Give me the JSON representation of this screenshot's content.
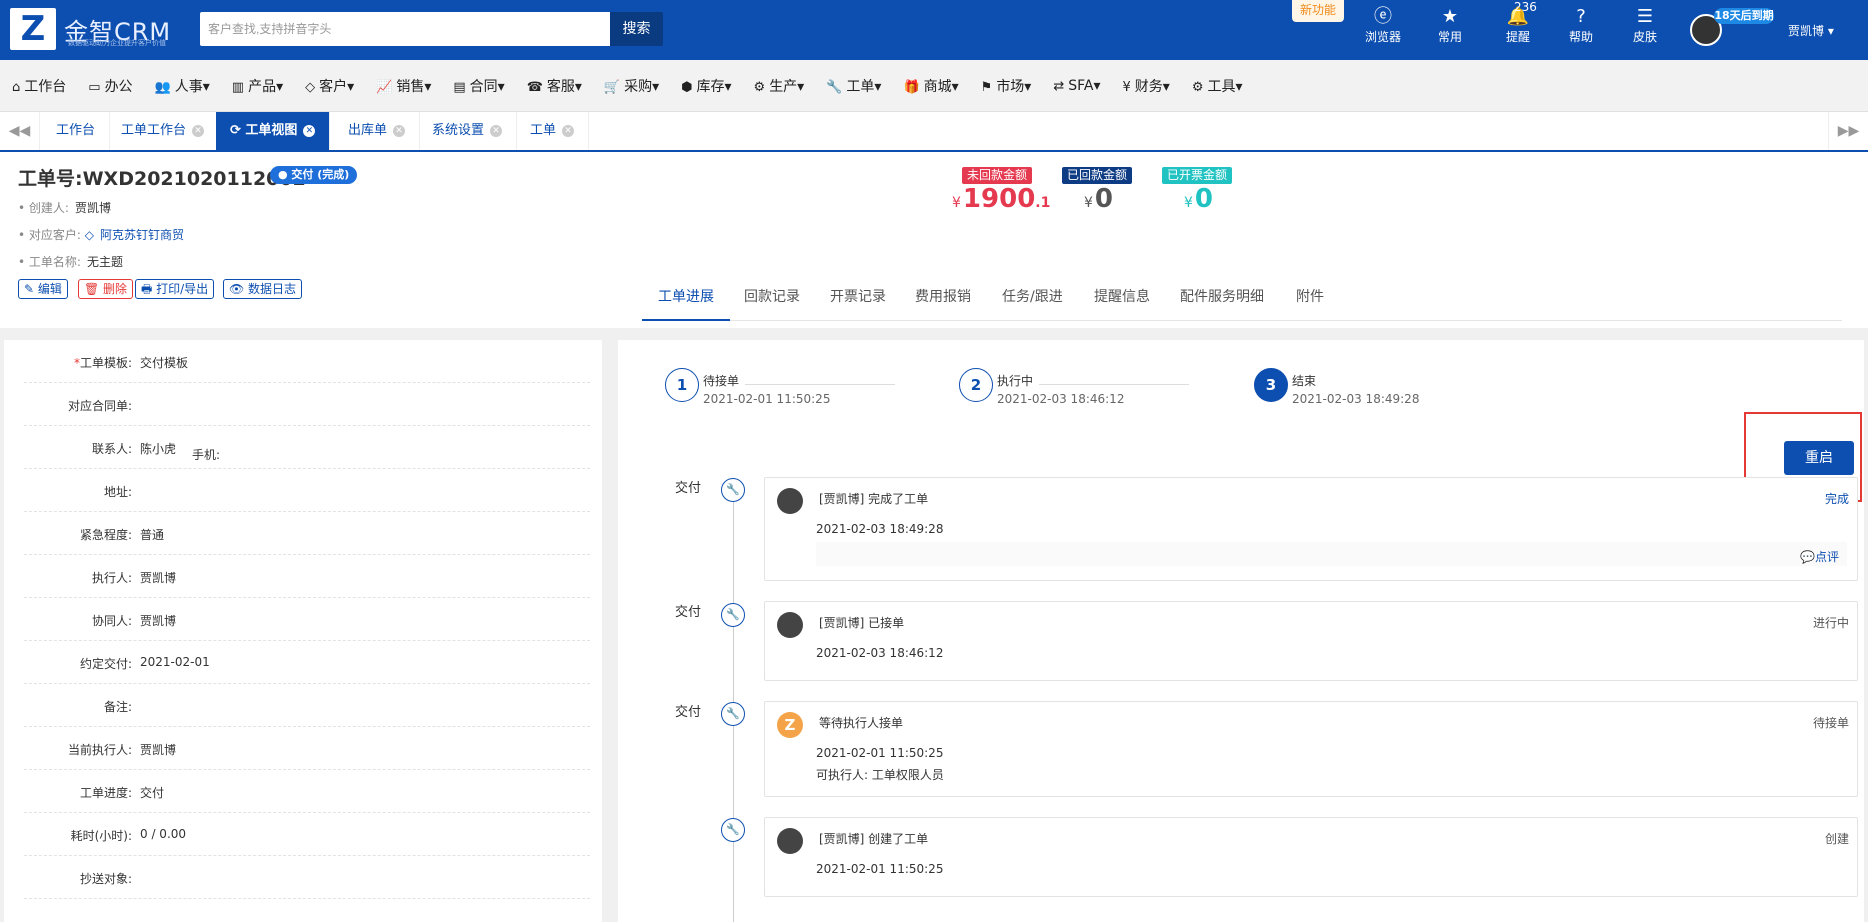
{
  "app": {
    "brand": "金智CRM",
    "slogan": "数据驱动助力企业提升客户价值",
    "search_placeholder": "客户查找,支持拼音字头",
    "search_button": "搜索",
    "new_feature": "新功能",
    "notifications_count": "236",
    "trial_badge": "18天后到期",
    "username": "贾凯博 ▾",
    "top_icons": [
      {
        "label": "浏览器",
        "icon": "ie-icon"
      },
      {
        "label": "常用",
        "icon": "star-icon"
      },
      {
        "label": "提醒",
        "icon": "bell-icon"
      },
      {
        "label": "帮助",
        "icon": "question-icon"
      },
      {
        "label": "皮肤",
        "icon": "skin-icon"
      }
    ]
  },
  "menu": [
    {
      "label": "工作台",
      "icon": "home-icon"
    },
    {
      "label": "办公",
      "icon": "laptop-icon"
    },
    {
      "label": "人事▾",
      "icon": "users-icon"
    },
    {
      "label": "产品▾",
      "icon": "barcode-icon"
    },
    {
      "label": "客户▾",
      "icon": "diamond-icon"
    },
    {
      "label": "销售▾",
      "icon": "chart-icon"
    },
    {
      "label": "合同▾",
      "icon": "contract-icon"
    },
    {
      "label": "客服▾",
      "icon": "phone-icon"
    },
    {
      "label": "采购▾",
      "icon": "cart-icon"
    },
    {
      "label": "库存▾",
      "icon": "cubes-icon"
    },
    {
      "label": "生产▾",
      "icon": "gears-icon"
    },
    {
      "label": "工单▾",
      "icon": "wrench-icon"
    },
    {
      "label": "商城▾",
      "icon": "gift-icon"
    },
    {
      "label": "市场▾",
      "icon": "flag-icon"
    },
    {
      "label": "SFA▾",
      "icon": "retweet-icon"
    },
    {
      "label": "财务▾",
      "icon": "yen-icon"
    },
    {
      "label": "工具▾",
      "icon": "cog-icon"
    }
  ],
  "tabs": [
    {
      "label": "工作台",
      "closable": false,
      "active": false
    },
    {
      "label": "工单工作台",
      "closable": true,
      "active": false
    },
    {
      "label": "工单视图",
      "closable": true,
      "active": true
    },
    {
      "label": "出库单",
      "closable": true,
      "active": false
    },
    {
      "label": "系统设置",
      "closable": true,
      "active": false
    },
    {
      "label": "工单",
      "closable": true,
      "active": false
    }
  ],
  "workorder": {
    "title": "工单号:WXD2021020112002",
    "status": "● 交付 (完成)",
    "creator_label": "创建人:",
    "creator": "贾凯博",
    "customer_label": "对应客户:",
    "customer": "阿克苏钉钉商贸",
    "name_label": "工单名称:",
    "name": "无主题",
    "actions": {
      "edit": "✎ 编辑",
      "delete": "🗑 删除",
      "print": "🖶 打印/导出",
      "log": "👁 数据日志"
    }
  },
  "amounts": [
    {
      "label": "未回款金额",
      "currency": "¥",
      "value": "1900",
      "decimal": ".1",
      "color": "#e53950"
    },
    {
      "label": "已回款金额",
      "currency": "¥",
      "value": "0",
      "decimal": "",
      "color": "#0d3c84"
    },
    {
      "label": "已开票金额",
      "currency": "¥",
      "value": "0",
      "decimal": "",
      "color": "#20c2c2"
    }
  ],
  "subtabs": [
    "工单进展",
    "回款记录",
    "开票记录",
    "费用报销",
    "任务/跟进",
    "提醒信息",
    "配件服务明细",
    "附件"
  ],
  "fields": [
    {
      "label": "工单模板:",
      "value": "交付模板",
      "required": true
    },
    {
      "label": "对应合同单:",
      "value": ""
    },
    {
      "label": "联系人:",
      "value": "陈小虎",
      "extra": "手机:"
    },
    {
      "label": "地址:",
      "value": ""
    },
    {
      "label": "紧急程度:",
      "value": "普通"
    },
    {
      "label": "执行人:",
      "value": "贾凯博"
    },
    {
      "label": "协同人:",
      "value": "贾凯博"
    },
    {
      "label": "约定交付:",
      "value": "2021-02-01"
    },
    {
      "label": "备注:",
      "value": ""
    },
    {
      "label": "当前执行人:",
      "value": "贾凯博"
    },
    {
      "label": "工单进度:",
      "value": "交付"
    },
    {
      "label": "耗时(小时):",
      "value": "0 / 0.00"
    },
    {
      "label": "抄送对象:",
      "value": ""
    }
  ],
  "steps": [
    {
      "num": "1",
      "title": "待接单",
      "date": "2021-02-01 11:50:25",
      "current": false
    },
    {
      "num": "2",
      "title": "执行中",
      "date": "2021-02-03 18:46:12",
      "current": false
    },
    {
      "num": "3",
      "title": "结束",
      "date": "2021-02-03 18:49:28",
      "current": true
    }
  ],
  "restart_button": "重启",
  "timeline": [
    {
      "kind": "交付",
      "title": "[贾凯博] 完成了工单",
      "time": "2021-02-03 18:49:28",
      "extra": "",
      "status": "完成",
      "comment": "💬点评",
      "avatar": "person"
    },
    {
      "kind": "交付",
      "title": "[贾凯博] 已接单",
      "time": "2021-02-03 18:46:12",
      "extra": "",
      "status": "进行中",
      "comment": "",
      "avatar": "person"
    },
    {
      "kind": "交付",
      "title": "等待执行人接单",
      "time": "2021-02-01 11:50:25",
      "extra": "可执行人: 工单权限人员",
      "status": "待接单",
      "comment": "",
      "avatar": "logo"
    },
    {
      "kind": "",
      "title": "[贾凯博] 创建了工单",
      "time": "2021-02-01 11:50:25",
      "extra": "",
      "status": "创建",
      "comment": "",
      "avatar": "person"
    }
  ]
}
